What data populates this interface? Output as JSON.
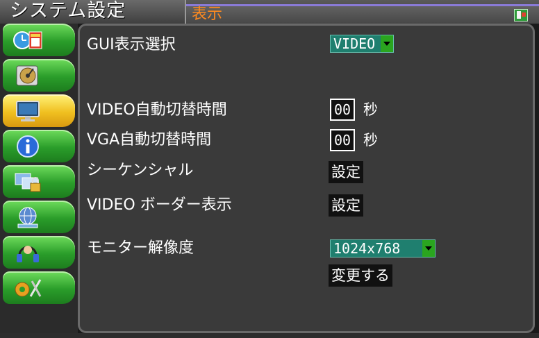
{
  "header": {
    "system_title": "システム設定",
    "page_title": "表示",
    "corner_icon": "exit-icon"
  },
  "sidebar": {
    "items": [
      {
        "icon": "clock-calendar-icon",
        "active": false
      },
      {
        "icon": "disk-icon",
        "active": false
      },
      {
        "icon": "monitor-icon",
        "active": true
      },
      {
        "icon": "info-icon",
        "active": false
      },
      {
        "icon": "network-lock-icon",
        "active": false
      },
      {
        "icon": "network-globe-icon",
        "active": false
      },
      {
        "icon": "headset-icon",
        "active": false
      },
      {
        "icon": "gear-tools-icon",
        "active": false
      }
    ]
  },
  "settings": {
    "gui_label": "GUI表示選択",
    "gui_value": "VIDEO",
    "video_switch_label": "VIDEO自動切替時間",
    "video_switch_value": "00",
    "vga_switch_label": "VGA自動切替時間",
    "vga_switch_value": "00",
    "seconds_unit": "秒",
    "sequential_label": "シーケンシャル",
    "setting_button": "設定",
    "border_label": "VIDEO ボーダー表示",
    "resolution_label": "モニター解像度",
    "resolution_value": "1024x768",
    "apply_button": "変更する"
  },
  "colors": {
    "page_title": "#ff8a1f",
    "select_bg": "#1f7f6f",
    "sidebar_green": "#2a9d2a",
    "sidebar_active": "#f0c020"
  }
}
